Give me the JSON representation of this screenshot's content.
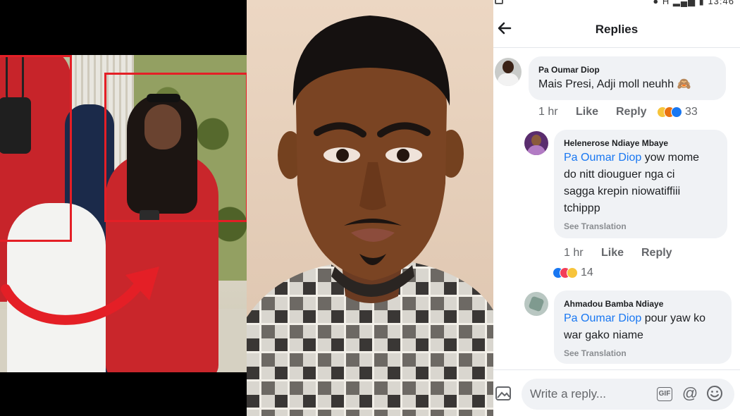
{
  "status_bar": {
    "signal": "H",
    "time": "13:46"
  },
  "header": {
    "title": "Replies"
  },
  "comment": {
    "author": "Pa Oumar Diop",
    "text": "Mais Presi, Adji moll neuhh 🙈",
    "time": "1 hr",
    "like_label": "Like",
    "reply_label": "Reply",
    "reaction_count": "33"
  },
  "replies": [
    {
      "author": "Helenerose Ndiaye Mbaye",
      "mention": "Pa Oumar Diop",
      "text_lines": [
        " yow mome",
        "do nitt diouguer nga ci",
        "sagga krepin niowatiffiii",
        "tchippp"
      ],
      "see_translation": "See Translation",
      "time": "1 hr",
      "like_label": "Like",
      "reply_label": "Reply",
      "reaction_count": "14"
    },
    {
      "author": "Ahmadou Bamba Ndiaye",
      "mention": "Pa Oumar Diop",
      "text_lines": [
        " pour yaw ko",
        "war gako niame"
      ],
      "see_translation": "See Translation"
    }
  ],
  "composer": {
    "placeholder": "Write a reply...",
    "gif_label": "GIF",
    "at_label": "@"
  },
  "colors": {
    "link": "#1877f2",
    "bubble": "#f0f2f5",
    "highlight_box": "#e41f26"
  }
}
